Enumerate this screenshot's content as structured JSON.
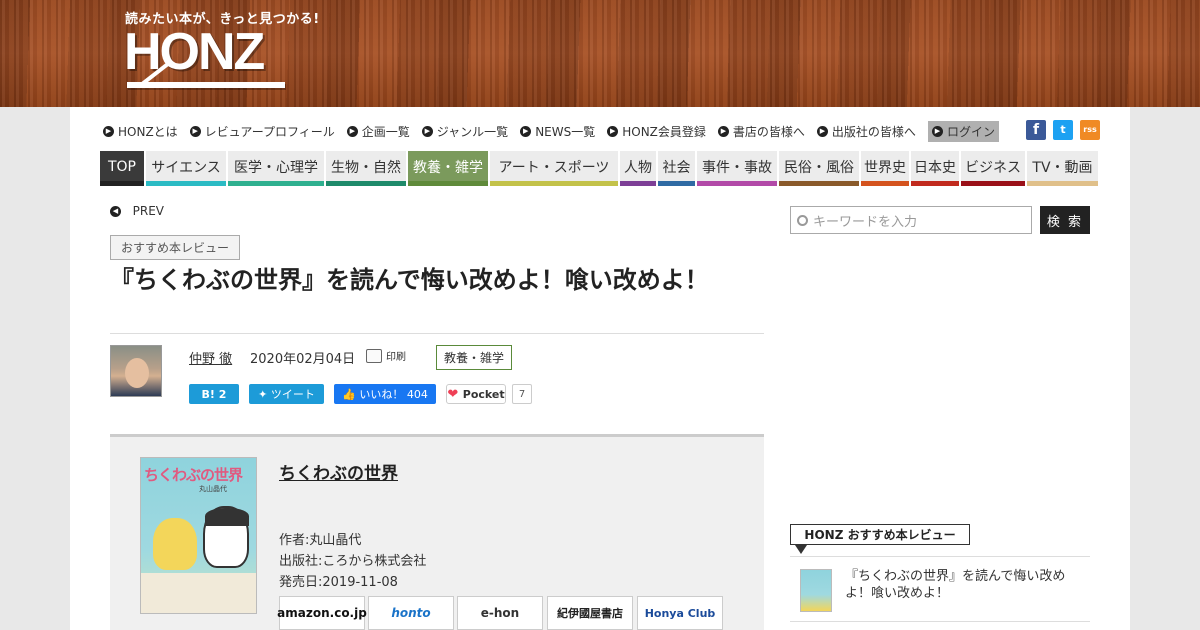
{
  "header": {
    "tagline": "読みたい本が、きっと見つかる!",
    "logo": "HONZ"
  },
  "topnav": {
    "items": [
      "HONZとは",
      "レビュアープロフィール",
      "企画一覧",
      "ジャンル一覧",
      "NEWS一覧",
      "HONZ会員登録",
      "書店の皆様へ",
      "出版社の皆様へ"
    ],
    "login": "ログイン"
  },
  "social": {
    "facebook": "f",
    "twitter": "t",
    "rss": "rss"
  },
  "genres": [
    {
      "label": "TOP",
      "color": "#222222"
    },
    {
      "label": "サイエンス",
      "color": "#2bbbc4"
    },
    {
      "label": "医学・心理学",
      "color": "#2fb08f"
    },
    {
      "label": "生物・自然",
      "color": "#1e8a6a"
    },
    {
      "label": "教養・雑学",
      "color": "#5f8a3a"
    },
    {
      "label": "アート・スポーツ",
      "color": "#c3c24a"
    },
    {
      "label": "人物",
      "color": "#7d3f96"
    },
    {
      "label": "社会",
      "color": "#2f6aa3"
    },
    {
      "label": "事件・事故",
      "color": "#b24aa8"
    },
    {
      "label": "民俗・風俗",
      "color": "#8a5a2a"
    },
    {
      "label": "世界史",
      "color": "#d4531e"
    },
    {
      "label": "日本史",
      "color": "#c12a1e"
    },
    {
      "label": "ビジネス",
      "color": "#9a1018"
    },
    {
      "label": "TV・動画",
      "color": "#e0c08a"
    }
  ],
  "article": {
    "prev": "PREV",
    "category": "おすすめ本レビュー",
    "title": "『ちくわぶの世界』を読んで悔い改めよ！喰い改めよ！",
    "author": "仲野 徹",
    "date": "2020年02月04日",
    "print": "印刷",
    "genre_tag": "教養・雑学",
    "share": {
      "hatena": "B! 2",
      "tweet": "ツイート",
      "like_label": "いいね！",
      "like_count": "404",
      "pocket": "Pocket",
      "pocket_count": "7"
    }
  },
  "book": {
    "title": "ちくわぶの世界",
    "cover_title": "ちくわぶの世界",
    "cover_author": "丸山晶代",
    "author": "作者:丸山晶代",
    "publisher": "出版社:ころから株式会社",
    "release": "発売日:2019-11-08",
    "shops": [
      "amazon.co.jp",
      "honto",
      "e-hon",
      "紀伊國屋書店",
      "Honya Club"
    ]
  },
  "sidebar": {
    "search_placeholder": "キーワードを入力",
    "search_button": "検 索",
    "section_title": "HONZ おすすめ本レビュー",
    "item": "『ちくわぶの世界』を読んで悔い改めよ！喰い改めよ！"
  }
}
